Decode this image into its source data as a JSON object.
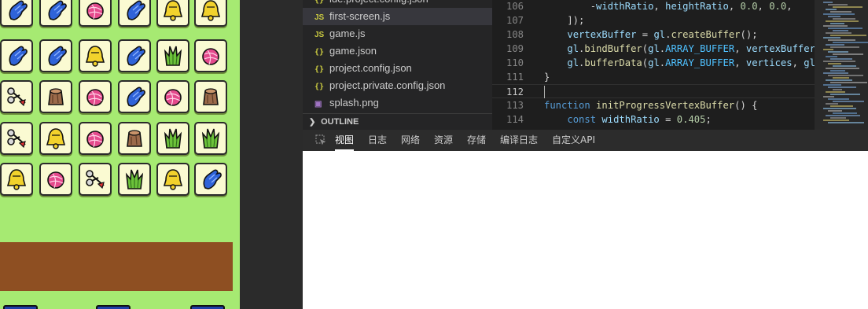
{
  "explorer": {
    "files": [
      {
        "name": "ide.project.config.json",
        "type": "json",
        "icon": "json-file-icon"
      },
      {
        "name": "first-screen.js",
        "type": "js",
        "icon": "js-file-icon",
        "selected": true
      },
      {
        "name": "game.js",
        "type": "js",
        "icon": "js-file-icon"
      },
      {
        "name": "game.json",
        "type": "json",
        "icon": "json-file-icon"
      },
      {
        "name": "project.config.json",
        "type": "json",
        "icon": "json-file-icon"
      },
      {
        "name": "project.private.config.json",
        "type": "json",
        "icon": "json-file-icon"
      },
      {
        "name": "splash.png",
        "type": "png",
        "icon": "image-file-icon"
      }
    ],
    "outline_label": "OUTLINE",
    "icon_glyphs": {
      "js": "JS",
      "json": "{}",
      "png": "▣"
    }
  },
  "editor": {
    "current_line": "112",
    "lines": [
      {
        "n": "106",
        "text": "        -widthRatio, heightRatio, 0.0, 0.0,"
      },
      {
        "n": "107",
        "text": "    ]);"
      },
      {
        "n": "108",
        "text": "    vertexBuffer = gl.createBuffer();"
      },
      {
        "n": "109",
        "text": "    gl.bindBuffer(gl.ARRAY_BUFFER, vertexBuffer);"
      },
      {
        "n": "110",
        "text": "    gl.bufferData(gl.ARRAY_BUFFER, vertices, gl.STATIC_DRAW);"
      },
      {
        "n": "111",
        "text": "}"
      },
      {
        "n": "112",
        "text": ""
      },
      {
        "n": "113",
        "text": "function initProgressVertexBuffer() {"
      },
      {
        "n": "114",
        "text": "    const widthRatio = 0.405;"
      }
    ]
  },
  "devtools": {
    "tabs": [
      "视图",
      "日志",
      "网络",
      "资源",
      "存储",
      "编译日志",
      "自定义API"
    ],
    "active_tab": "视图"
  },
  "game": {
    "tiles": [
      [
        "glove",
        "glove",
        "yarn",
        "glove",
        "bell",
        "bell"
      ],
      [
        "glove",
        "glove",
        "bell",
        "glove",
        "cabbage",
        "yarn"
      ],
      [
        "scissors",
        "stump",
        "yarn",
        "glove",
        "yarn",
        "stump"
      ],
      [
        "scissors",
        "bell",
        "yarn",
        "stump",
        "cabbage",
        "cabbage"
      ],
      [
        "bell",
        "yarn",
        "scissors",
        "cabbage",
        "bell",
        "glove"
      ]
    ],
    "colors": {
      "background": "#a6ea72",
      "bar": "#8e4f22",
      "slot": "#1e3fa8",
      "tile": "#fafad2"
    }
  }
}
